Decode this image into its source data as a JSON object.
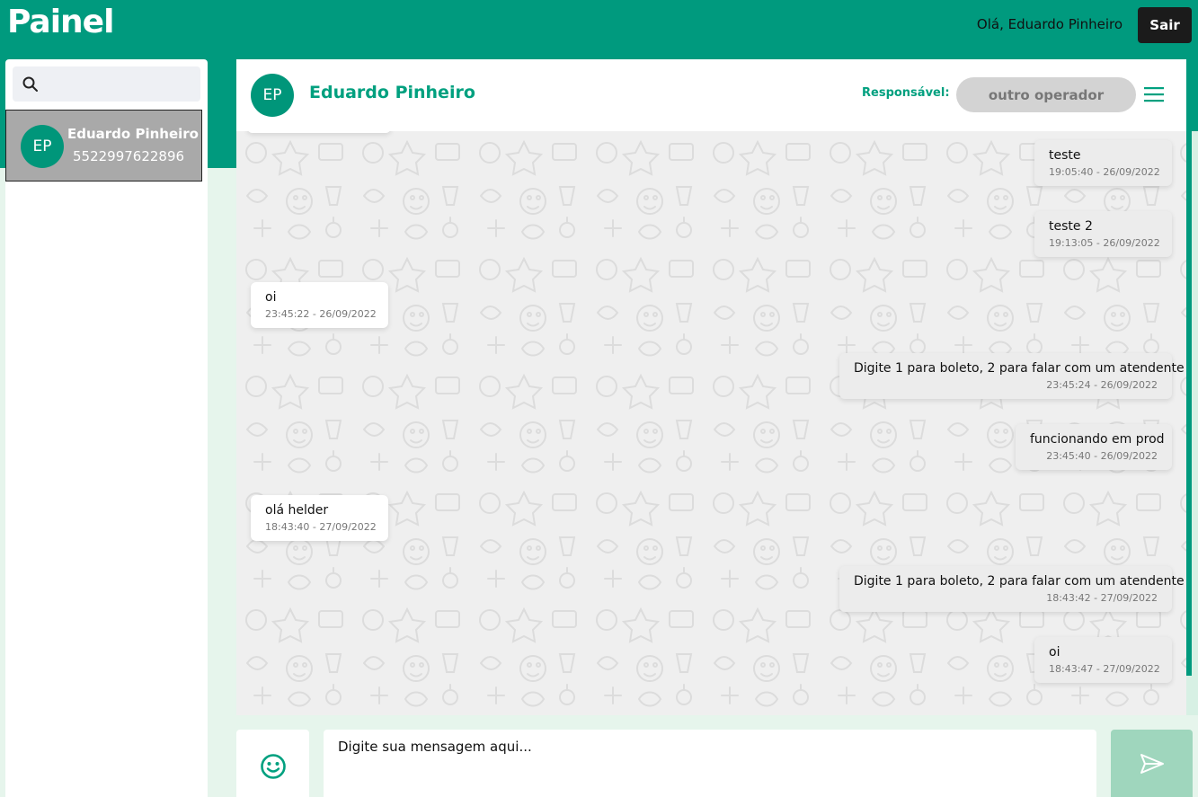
{
  "app": {
    "title": "Painel",
    "greeting": "Olá, Eduardo Pinheiro",
    "logout_label": "Sair"
  },
  "sidebar": {
    "search": {
      "placeholder": "",
      "value": ""
    },
    "contacts": [
      {
        "initials": "EP",
        "name": "Eduardo Pinheiro",
        "phone": "5522997622896",
        "selected": true
      }
    ]
  },
  "chat": {
    "header": {
      "initials": "EP",
      "name": "Eduardo Pinheiro",
      "responsible_label": "Responsável:",
      "operator": "outro operador"
    },
    "messages": [
      {
        "direction": "out",
        "text": "teste",
        "time": "19:05:40 - 26/09/2022"
      },
      {
        "direction": "out",
        "text": "teste 2",
        "time": "19:13:05 - 26/09/2022"
      },
      {
        "direction": "in",
        "text": "oi",
        "time": "23:45:22 - 26/09/2022"
      },
      {
        "direction": "out",
        "text": "Digite 1 para boleto, 2 para falar com um atendente",
        "time": "23:45:24 - 26/09/2022"
      },
      {
        "direction": "out",
        "text": "funcionando em prod",
        "time": "23:45:40 - 26/09/2022"
      },
      {
        "direction": "in",
        "text": "olá helder",
        "time": "18:43:40 - 27/09/2022"
      },
      {
        "direction": "out",
        "text": "Digite 1 para boleto, 2 para falar com um atendente",
        "time": "18:43:42 - 27/09/2022"
      },
      {
        "direction": "out",
        "text": "oi",
        "time": "18:43:47 - 27/09/2022"
      }
    ],
    "composer": {
      "placeholder": "Digite sua mensagem aqui...",
      "value": ""
    }
  },
  "colors": {
    "brand": "#009a7e",
    "accent_text": "#00a07f",
    "page_bg": "#e6f5ec",
    "send_button": "#9fd6bd"
  },
  "icons": [
    "search-icon",
    "menu-icon",
    "emoji-icon",
    "send-icon"
  ]
}
